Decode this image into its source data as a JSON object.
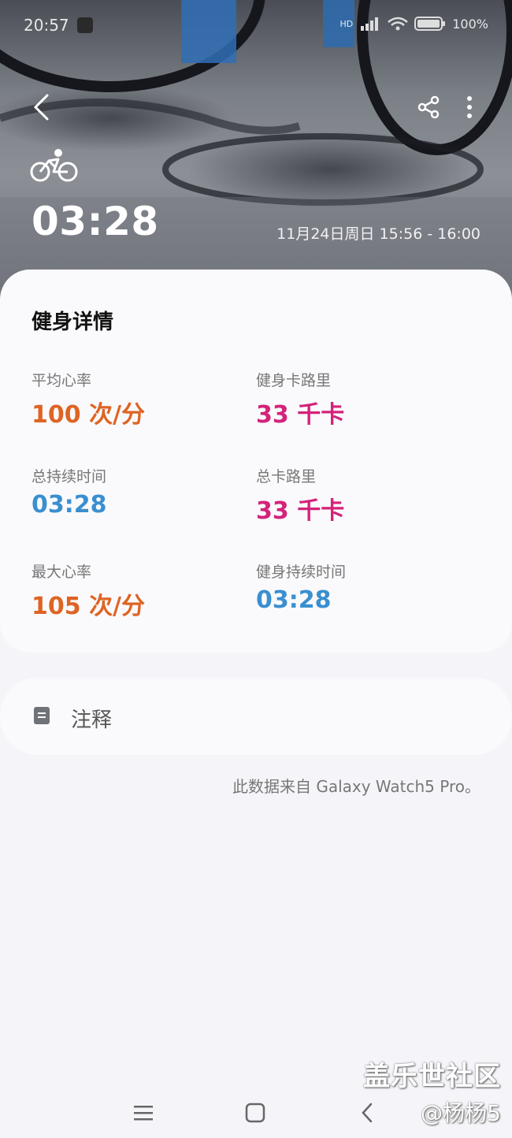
{
  "status_bar": {
    "time": "20:57",
    "network_label": "HD",
    "battery_percent": "100%"
  },
  "header": {
    "back_icon": "chevron-left-icon",
    "share_icon": "share-icon",
    "more_icon": "more-vertical-icon",
    "activity_icon": "cycling-icon",
    "duration": "03:28",
    "date_range": "11月24日周日 15:56 - 16:00"
  },
  "details": {
    "title": "健身详情",
    "metrics": [
      {
        "label": "平均心率",
        "value": "100 次/分",
        "color": "#de6424"
      },
      {
        "label": "健身卡路里",
        "value": "33 千卡",
        "color": "#d4227a"
      },
      {
        "label": "总持续时间",
        "value": "03:28",
        "color": "#3a8fcf"
      },
      {
        "label": "总卡路里",
        "value": "33 千卡",
        "color": "#d4227a"
      },
      {
        "label": "最大心率",
        "value": "105 次/分",
        "color": "#de6424"
      },
      {
        "label": "健身持续时间",
        "value": "03:28",
        "color": "#3a8fcf"
      }
    ]
  },
  "notes": {
    "icon": "note-icon",
    "label": "注释"
  },
  "source_text": "此数据来自 Galaxy Watch5 Pro。",
  "watermark": {
    "line1": "盖乐世社区",
    "line2": "@杨杨5"
  },
  "nav_bar": {
    "recents_icon": "menu-lines-icon",
    "home_icon": "home-square-icon",
    "back_icon": "back-chevron-icon"
  }
}
